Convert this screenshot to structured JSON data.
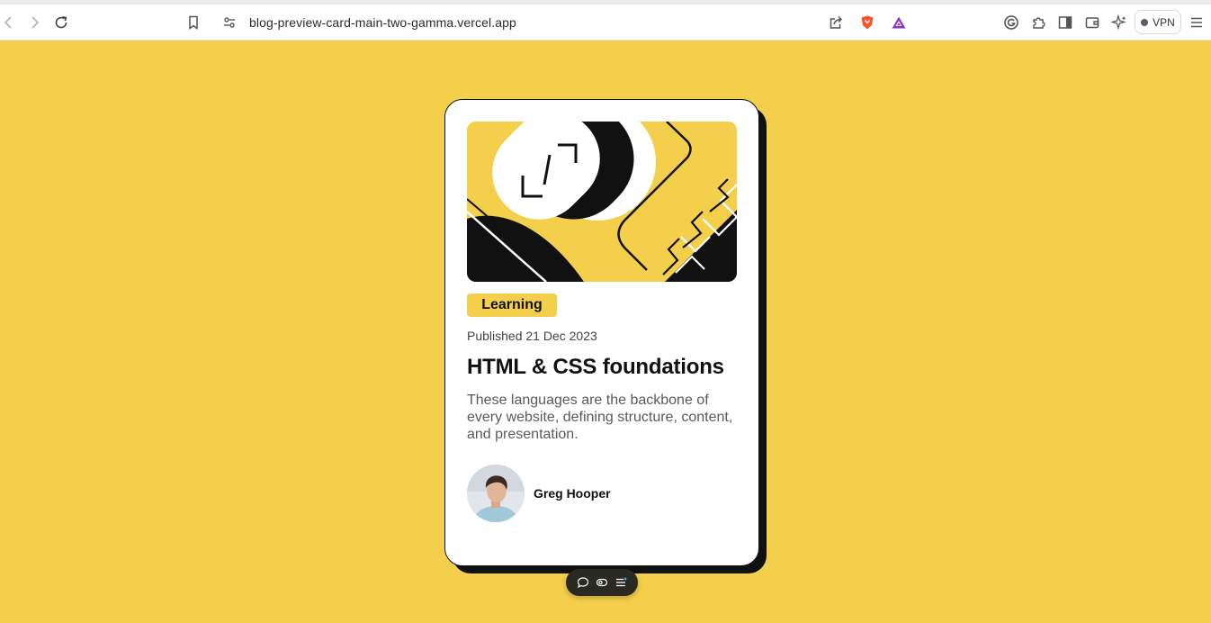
{
  "browser": {
    "url": "blog-preview-card-main-two-gamma.vercel.app",
    "vpn_label": "VPN",
    "icons": [
      "back-icon",
      "forward-icon",
      "reload-icon",
      "bookmark-icon",
      "site-settings-icon",
      "share-icon",
      "brave-shield-icon",
      "brave-rewards-icon",
      "grammarly-icon",
      "extensions-icon",
      "sidebar-icon",
      "wallet-icon",
      "leo-ai-icon",
      "menu-icon"
    ]
  },
  "card": {
    "tag": "Learning",
    "published": "Published 21 Dec 2023",
    "title": "HTML & CSS foundations",
    "description": "These languages are the backbone of every website, defining structure, content, and presentation.",
    "author": "Greg Hooper"
  },
  "floating_toolbar": {
    "icons": [
      "comment-icon",
      "visibility-icon",
      "menu-lines-icon"
    ]
  },
  "colors": {
    "background": "#f4cf4c",
    "card": "#ffffff",
    "ink": "#111111",
    "tag": "#f4cf4c",
    "muted_text": "#5a5a5a"
  }
}
